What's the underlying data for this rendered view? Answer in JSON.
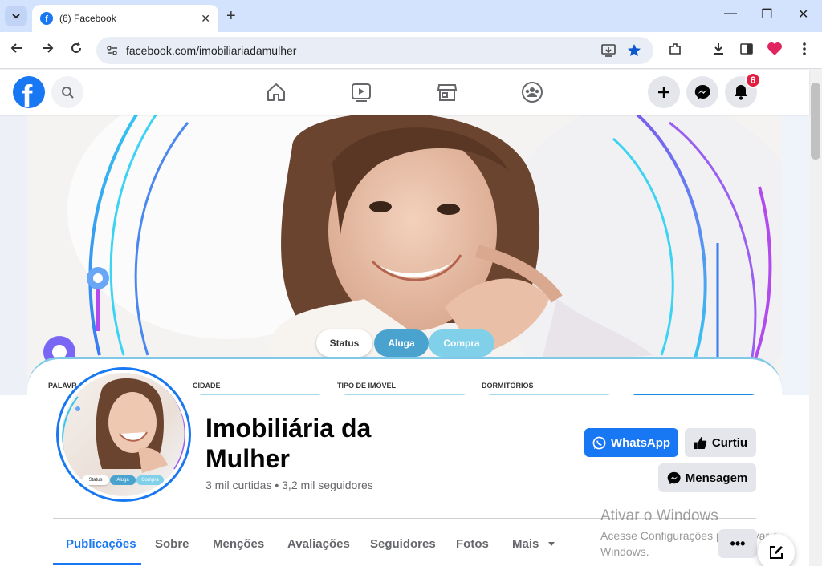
{
  "browser": {
    "tab_title": "(6) Facebook",
    "tab_close": "✕",
    "new_tab": "+",
    "url": "facebook.com/imobiliariadamulher",
    "window_controls": {
      "minimize": "—",
      "restore": "❐",
      "close": "✕"
    }
  },
  "facebook_header": {
    "logo_letter": "f",
    "notifications_count": "6"
  },
  "cover": {
    "pills": [
      "Status",
      "Aluga",
      "Compra"
    ],
    "form_labels": [
      "PALAVR",
      "CIDADE",
      "TIPO DE IMÓVEL",
      "DORMITÓRIOS"
    ]
  },
  "avatar": {
    "pills": [
      "Status",
      "Aluga",
      "Compra"
    ]
  },
  "profile": {
    "name": "Imobiliária da Mulher",
    "stats": "3 mil curtidas • 3,2 mil seguidores",
    "buttons": {
      "whatsapp": "WhatsApp",
      "liked": "Curtiu",
      "message": "Mensagem"
    }
  },
  "tabs": [
    "Publicações",
    "Sobre",
    "Menções",
    "Avaliações",
    "Seguidores",
    "Fotos",
    "Mais"
  ],
  "more_options": "•••",
  "windows_watermark": {
    "title": "Ativar o Windows",
    "subtitle": "Acesse Configurações para ativar o Windows."
  },
  "colors": {
    "facebook_blue": "#1877f2",
    "badge_red": "#e41e3f"
  }
}
